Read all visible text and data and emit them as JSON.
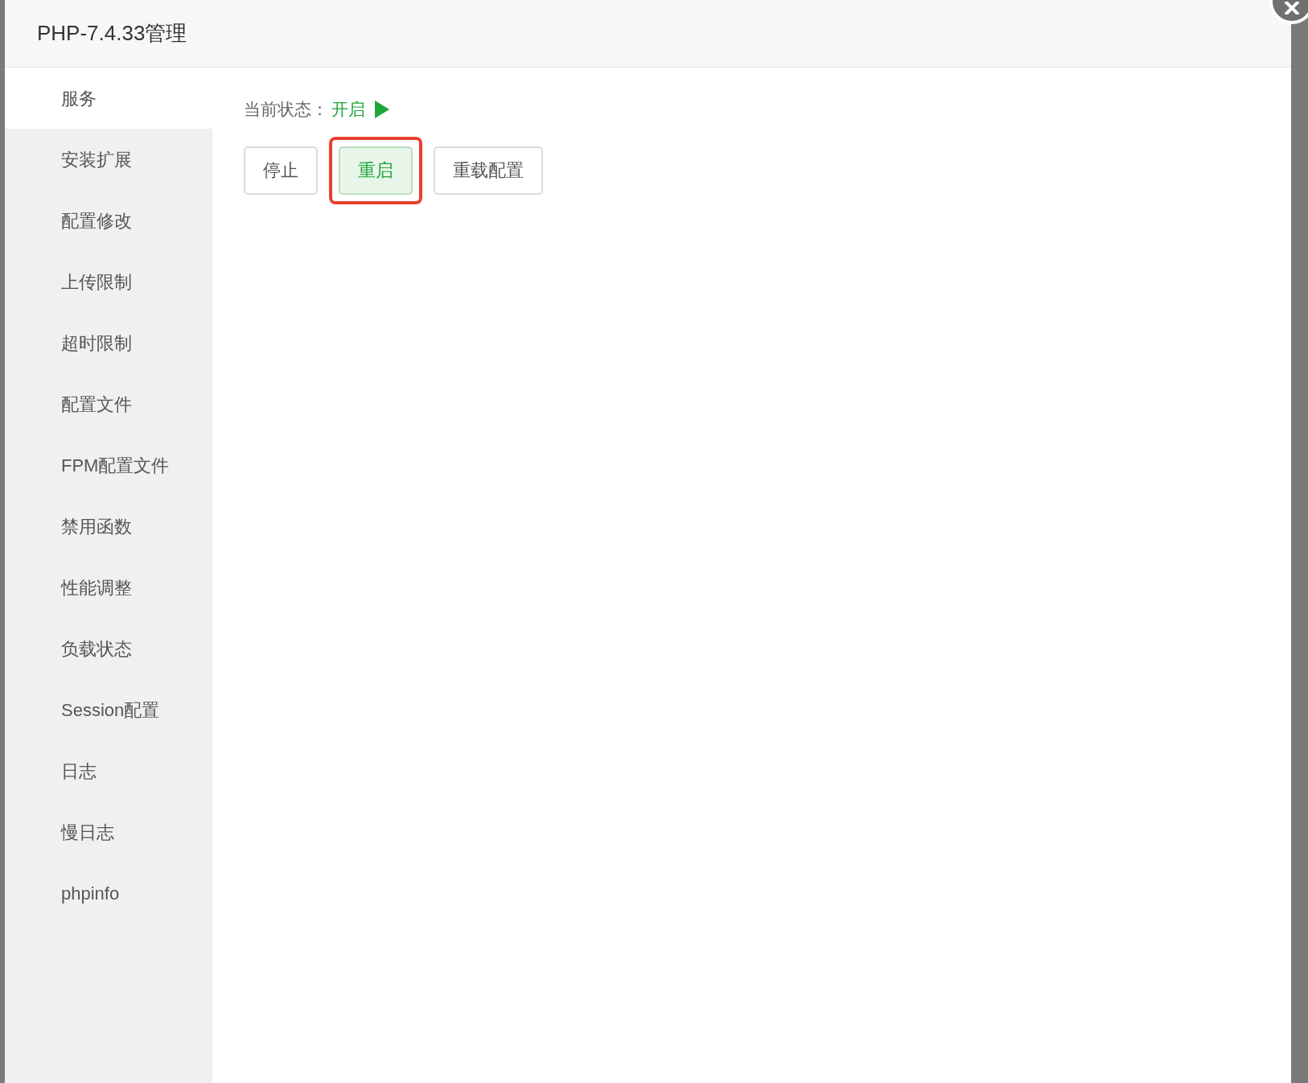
{
  "dialog": {
    "title": "PHP-7.4.33管理"
  },
  "sidebar": {
    "items": [
      {
        "label": "服务",
        "selected": true
      },
      {
        "label": "安装扩展",
        "selected": false
      },
      {
        "label": "配置修改",
        "selected": false
      },
      {
        "label": "上传限制",
        "selected": false
      },
      {
        "label": "超时限制",
        "selected": false
      },
      {
        "label": "配置文件",
        "selected": false
      },
      {
        "label": "FPM配置文件",
        "selected": false
      },
      {
        "label": "禁用函数",
        "selected": false
      },
      {
        "label": "性能调整",
        "selected": false
      },
      {
        "label": "负载状态",
        "selected": false
      },
      {
        "label": "Session配置",
        "selected": false
      },
      {
        "label": "日志",
        "selected": false
      },
      {
        "label": "慢日志",
        "selected": false
      },
      {
        "label": "phpinfo",
        "selected": false
      }
    ]
  },
  "status": {
    "label": "当前状态：",
    "value": "开启",
    "running": true
  },
  "buttons": [
    {
      "label": "停止",
      "kind": "plain",
      "highlighted": false
    },
    {
      "label": "重启",
      "kind": "success",
      "highlighted": true
    },
    {
      "label": "重载配置",
      "kind": "plain",
      "highlighted": false
    }
  ]
}
